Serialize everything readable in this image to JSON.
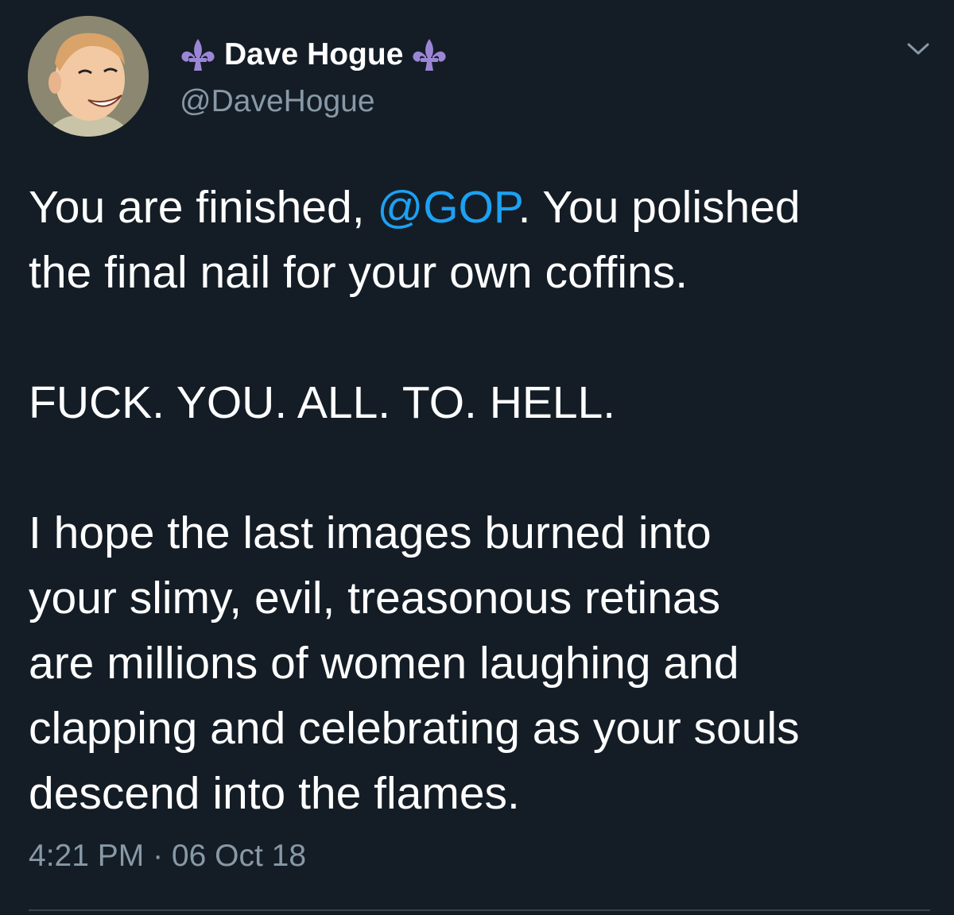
{
  "tweet": {
    "display_name": "Dave Hogue",
    "handle": "@DaveHogue",
    "body": {
      "line1_before": "You are finished, ",
      "mention": "@GOP",
      "line1_after": ". You polished",
      "line2": "the final nail for your own coffins.",
      "line3": "FUCK. YOU. ALL. TO. HELL.",
      "line4": "I hope the last images burned into",
      "line5": "your slimy, evil, treasonous retinas",
      "line6": "are millions of women laughing and",
      "line7": "clapping and celebrating as your souls",
      "line8": "descend into the flames."
    },
    "time": "4:21 PM",
    "separator": " · ",
    "date": "06 Oct 18"
  },
  "icons": {
    "name_prefix": "fleur-de-lis-icon",
    "name_suffix": "fleur-de-lis-icon",
    "menu": "chevron-down-icon"
  },
  "colors": {
    "background": "#141d26",
    "text": "#ffffff",
    "secondary": "#8899a6",
    "link": "#1da1f2",
    "fleur": "#9b86d6",
    "divider": "#38444d"
  }
}
